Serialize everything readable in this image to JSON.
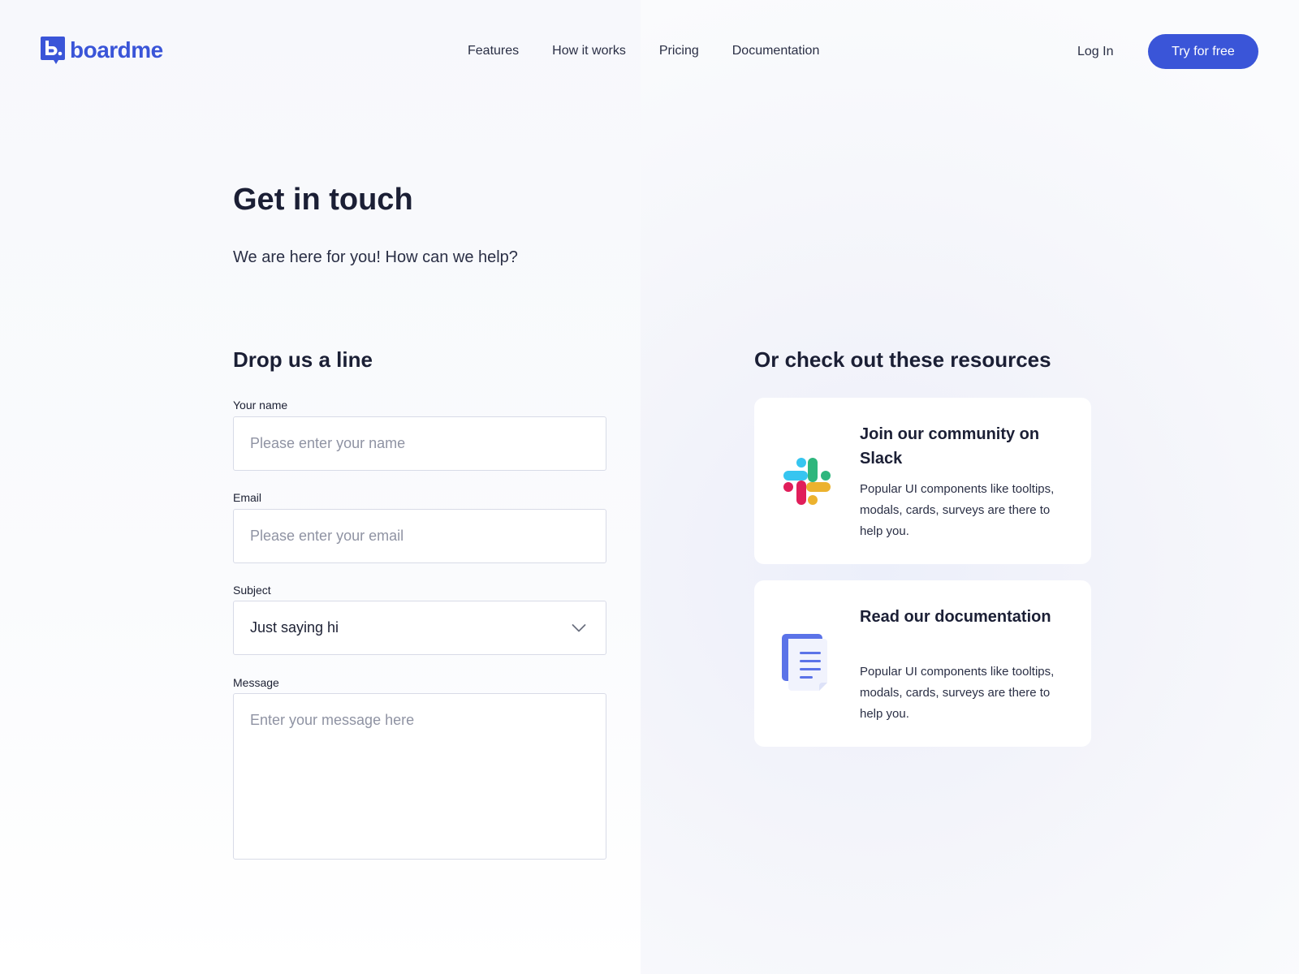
{
  "brand": {
    "name": "boardme",
    "color": "#3a55d8"
  },
  "nav": {
    "items": [
      "Features",
      "How it works",
      "Pricing",
      "Documentation"
    ],
    "login": "Log In",
    "cta": "Try for free"
  },
  "hero": {
    "title": "Get in touch",
    "subtitle": "We are here for you! How can we help?"
  },
  "form": {
    "heading": "Drop us a line",
    "name": {
      "label": "Your name",
      "placeholder": "Please enter your name",
      "value": ""
    },
    "email": {
      "label": "Email",
      "placeholder": "Please enter your email",
      "value": ""
    },
    "subject": {
      "label": "Subject",
      "value": "Just saying hi"
    },
    "message": {
      "label": "Message",
      "placeholder": "Enter your message here",
      "value": ""
    }
  },
  "resources": {
    "heading": "Or check out these resources",
    "cards": [
      {
        "icon": "slack-icon",
        "title": "Join our community on Slack",
        "desc": "Popular UI components like tooltips, modals, cards, surveys are there to help you."
      },
      {
        "icon": "document-icon",
        "title": "Read our documentation",
        "desc": "Popular UI components like tooltips, modals, cards, surveys are there to help you."
      }
    ]
  }
}
